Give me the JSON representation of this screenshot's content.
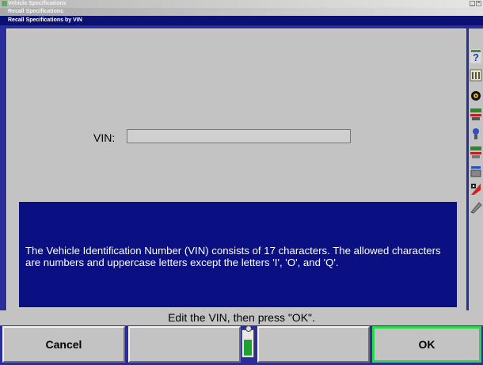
{
  "window": {
    "title": "Vehicle Specifications",
    "subtitle": "Recall Specifications",
    "dialog_title": "Recall Specifications by VIN"
  },
  "form": {
    "vin_label": "VIN:",
    "vin_value": ""
  },
  "info": {
    "text": "The Vehicle Identification Number (VIN) consists of 17 characters. The allowed characters are numbers and uppercase letters except the letters 'I', 'O', and 'Q'."
  },
  "status": {
    "text": "Edit the VIN, then press \"OK\"."
  },
  "buttons": {
    "cancel": "Cancel",
    "f2": "",
    "f3": "",
    "ok": "OK"
  },
  "toolbar": {
    "icons": [
      "help-icon",
      "specs-binder-icon",
      "wheel-icon",
      "toe-adjust-icon",
      "camber-icon",
      "caster-icon",
      "vehicle-icon",
      "racing-flag-icon",
      "tool-icon"
    ]
  },
  "colors": {
    "dialog_bar": "#0a1170",
    "info_box": "#0a0f82",
    "ok_border": "#29d84a"
  }
}
